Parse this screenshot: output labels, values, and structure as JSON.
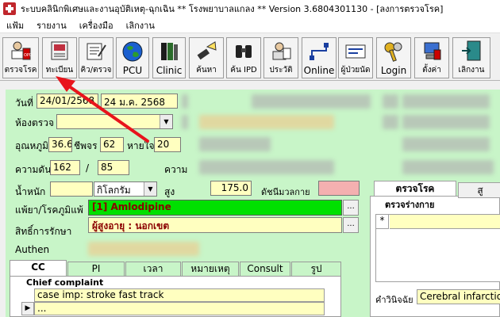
{
  "window": {
    "title": "ระบบคลินิกพิเศษและงานอุบัติเหตุ-ฉุกเฉิน  ** โรงพยาบาลแกลง **  Version 3.6804301130 - [ลงการตรวจโรค]"
  },
  "menu": [
    "แฟ้ม",
    "รายงาน",
    "เครื่องมือ",
    "เลิกงาน"
  ],
  "toolbar": [
    {
      "label": "ตรวจโรค",
      "icon": "doctor-icon"
    },
    {
      "label": "ทะเบียน",
      "icon": "registry-book-icon"
    },
    {
      "label": "คิว/ตรวจ",
      "icon": "queue-icon"
    },
    {
      "label": "PCU",
      "icon": "globe-icon"
    },
    {
      "label": "Clinic",
      "icon": "binders-icon"
    },
    {
      "label": "ค้นหา",
      "icon": "flashlight-icon"
    },
    {
      "label": "ค้น IPD",
      "icon": "binoculars-icon"
    },
    {
      "label": "ประวัติ",
      "icon": "history-icon"
    },
    {
      "label": "Online",
      "icon": "network-icon"
    },
    {
      "label": "ผู้ป่วยนัด",
      "icon": "appointment-icon"
    },
    {
      "label": "Login",
      "icon": "keys-icon"
    },
    {
      "label": "ตั้งค่า",
      "icon": "computer-settings-icon"
    },
    {
      "label": "เลิกงาน",
      "icon": "exit-door-icon"
    }
  ],
  "form": {
    "date_label": "วันที่",
    "date_value": "24/01/2568",
    "date_text": "24 ม.ค. 2568",
    "room_label": "ห้องตรวจ",
    "temp_label": "อุณหภูมิ",
    "temp_value": "36.6",
    "pulse_label": "ชีพจร",
    "pulse_value": "62",
    "resp_label": "หายใจ",
    "resp_value": "20",
    "bp_label": "ความดัน",
    "bp_sys": "162",
    "bp_sep": "/",
    "bp_dia": "85",
    "pressure_label2": "ความ",
    "weight_label": "น้ำหนัก",
    "weight_unit": "กิโลกรัม",
    "height_label": "สูง",
    "height_value": "175.0",
    "bmi_label": "ดัชนีมวลกาย",
    "allergy_label": "แพ้ยา/โรคภูมิแพ้",
    "allergy_value": "[1] Amlodipine",
    "rights_label": "สิทธิ์การรักษา",
    "rights_value": "ผู้สูงอายุ : นอกเขต",
    "authen_label": "Authen",
    "dots": "..."
  },
  "tabs_left": [
    "CC",
    "PI",
    "เวลา",
    "หมายเหตุ",
    "Consult",
    "รูป"
  ],
  "cc": {
    "group_label": "Chief complaint",
    "row1": "case  imp: stroke fast track",
    "row2": "..."
  },
  "right": {
    "tab1": "ตรวจโรค",
    "tab2": "สู",
    "subtab": "ตรวจร่างกาย",
    "grid_marker": "*",
    "diag_label": "คำวินิจฉัย",
    "diag_value": "Cerebral infarction"
  },
  "colors": {
    "form_bg": "#c8f5c8",
    "yellow_field": "#ffffc0",
    "allergy_bg": "#00e000",
    "bmi_pink": "#f4b0b0",
    "arrow_red": "#e8141c"
  }
}
